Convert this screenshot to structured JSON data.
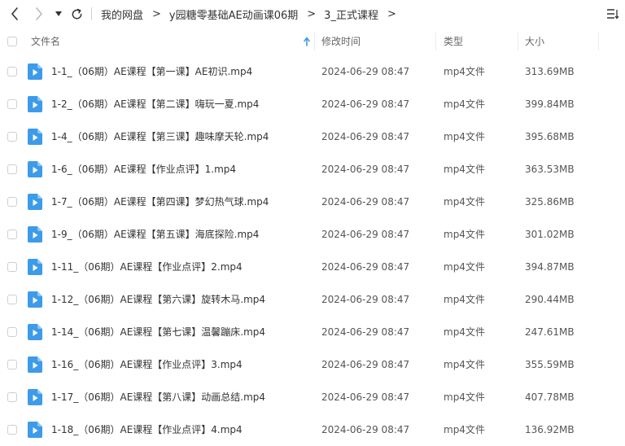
{
  "breadcrumb": [
    "我的网盘",
    "y园糖零基础AE动画课06期",
    "3_正式课程"
  ],
  "columns": {
    "name": "文件名",
    "modified": "修改时间",
    "type": "类型",
    "size": "大小"
  },
  "files": [
    {
      "name": "1-1_（06期）AE课程【第一课】AE初识.mp4",
      "modified": "2024-06-29 08:47",
      "type": "mp4文件",
      "size": "313.69MB"
    },
    {
      "name": "1-2_（06期）AE课程【第二课】嗨玩一夏.mp4",
      "modified": "2024-06-29 08:47",
      "type": "mp4文件",
      "size": "399.84MB"
    },
    {
      "name": "1-4_（06期）AE课程【第三课】趣味摩天轮.mp4",
      "modified": "2024-06-29 08:47",
      "type": "mp4文件",
      "size": "395.68MB"
    },
    {
      "name": "1-6_（06期）AE课程【作业点评】1.mp4",
      "modified": "2024-06-29 08:47",
      "type": "mp4文件",
      "size": "363.53MB"
    },
    {
      "name": "1-7_（06期）AE课程【第四课】梦幻热气球.mp4",
      "modified": "2024-06-29 08:47",
      "type": "mp4文件",
      "size": "325.86MB"
    },
    {
      "name": "1-9_（06期）AE课程【第五课】海底探险.mp4",
      "modified": "2024-06-29 08:47",
      "type": "mp4文件",
      "size": "301.02MB"
    },
    {
      "name": "1-11_（06期）AE课程【作业点评】2.mp4",
      "modified": "2024-06-29 08:47",
      "type": "mp4文件",
      "size": "394.87MB"
    },
    {
      "name": "1-12_（06期）AE课程【第六课】旋转木马.mp4",
      "modified": "2024-06-29 08:47",
      "type": "mp4文件",
      "size": "290.44MB"
    },
    {
      "name": "1-14_（06期）AE课程【第七课】温馨蹦床.mp4",
      "modified": "2024-06-29 08:47",
      "type": "mp4文件",
      "size": "247.61MB"
    },
    {
      "name": "1-16_（06期）AE课程【作业点评】3.mp4",
      "modified": "2024-06-29 08:47",
      "type": "mp4文件",
      "size": "355.59MB"
    },
    {
      "name": "1-17_（06期）AE课程【第八课】动画总结.mp4",
      "modified": "2024-06-29 08:47",
      "type": "mp4文件",
      "size": "407.78MB"
    },
    {
      "name": "1-18_（06期）AE课程【作业点评】4.mp4",
      "modified": "2024-06-29 08:47",
      "type": "mp4文件",
      "size": "136.92MB"
    }
  ],
  "icons": {
    "back": "chevron-left-icon",
    "forward": "chevron-right-icon",
    "history": "caret-down-icon",
    "refresh": "refresh-icon",
    "sort_menu": "sort-list-icon",
    "sort_arrow": "arrow-up-icon",
    "file": "video-file-icon"
  },
  "colors": {
    "file_icon": "#3d9be9",
    "sort_arrow": "#3d9be9"
  }
}
